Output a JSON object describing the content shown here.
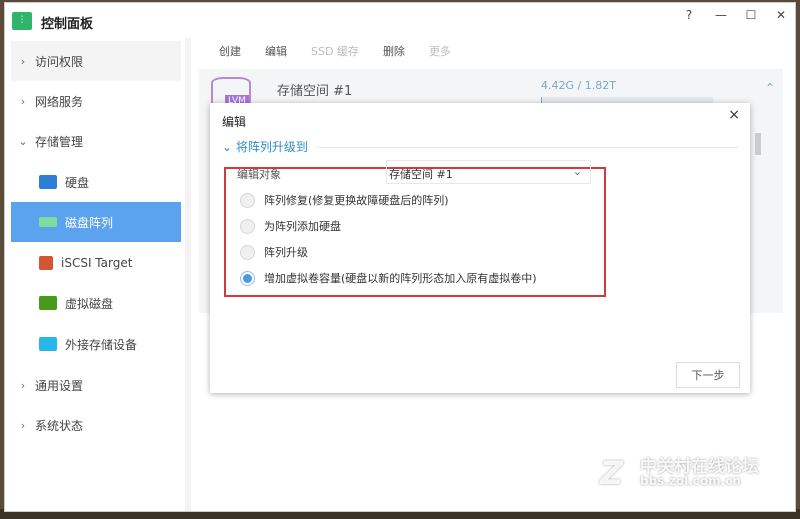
{
  "window": {
    "title": "控制面板",
    "help": "?",
    "minimize": "—",
    "maximize": "☐",
    "close": "✕"
  },
  "sidebar": {
    "items": [
      {
        "label": "访问权限",
        "chev": "›"
      },
      {
        "label": "网络服务",
        "chev": "›"
      },
      {
        "label": "存储管理",
        "chev": "⌄"
      },
      {
        "label": "硬盘"
      },
      {
        "label": "磁盘阵列"
      },
      {
        "label": "iSCSI Target"
      },
      {
        "label": "虚拟磁盘"
      },
      {
        "label": "外接存储设备"
      },
      {
        "label": "通用设置",
        "chev": "›"
      },
      {
        "label": "系统状态",
        "chev": "›"
      }
    ]
  },
  "toolbar": {
    "create": "创建",
    "edit": "编辑",
    "ssd_cache": "SSD 缓存",
    "delete": "删除",
    "more": "更多"
  },
  "card": {
    "badge": "LVM",
    "name": "存储空间 #1",
    "capacity": "4.42G / 1.82T",
    "usage_fraction": 0.0024,
    "collapse": "⌃"
  },
  "dialog": {
    "title": "编辑",
    "close": "×",
    "section": "将阵列升级到",
    "target_label": "编辑对象",
    "target_value": "存储空间 #1",
    "options": [
      {
        "label": "阵列修复(修复更换故障硬盘后的阵列)",
        "selected": false
      },
      {
        "label": "为阵列添加硬盘",
        "selected": false
      },
      {
        "label": "阵列升级",
        "selected": false
      },
      {
        "label": "增加虚拟卷容量(硬盘以新的阵列形态加入原有虚拟卷中)",
        "selected": true
      }
    ],
    "next": "下一步"
  },
  "watermark": {
    "line1": "中关村在线论坛",
    "line2": "bbs.zol.com.cn"
  },
  "colors": {
    "accent": "#5ba3ee",
    "highlight": "#d43a3a",
    "logo": "#2fb56a"
  }
}
